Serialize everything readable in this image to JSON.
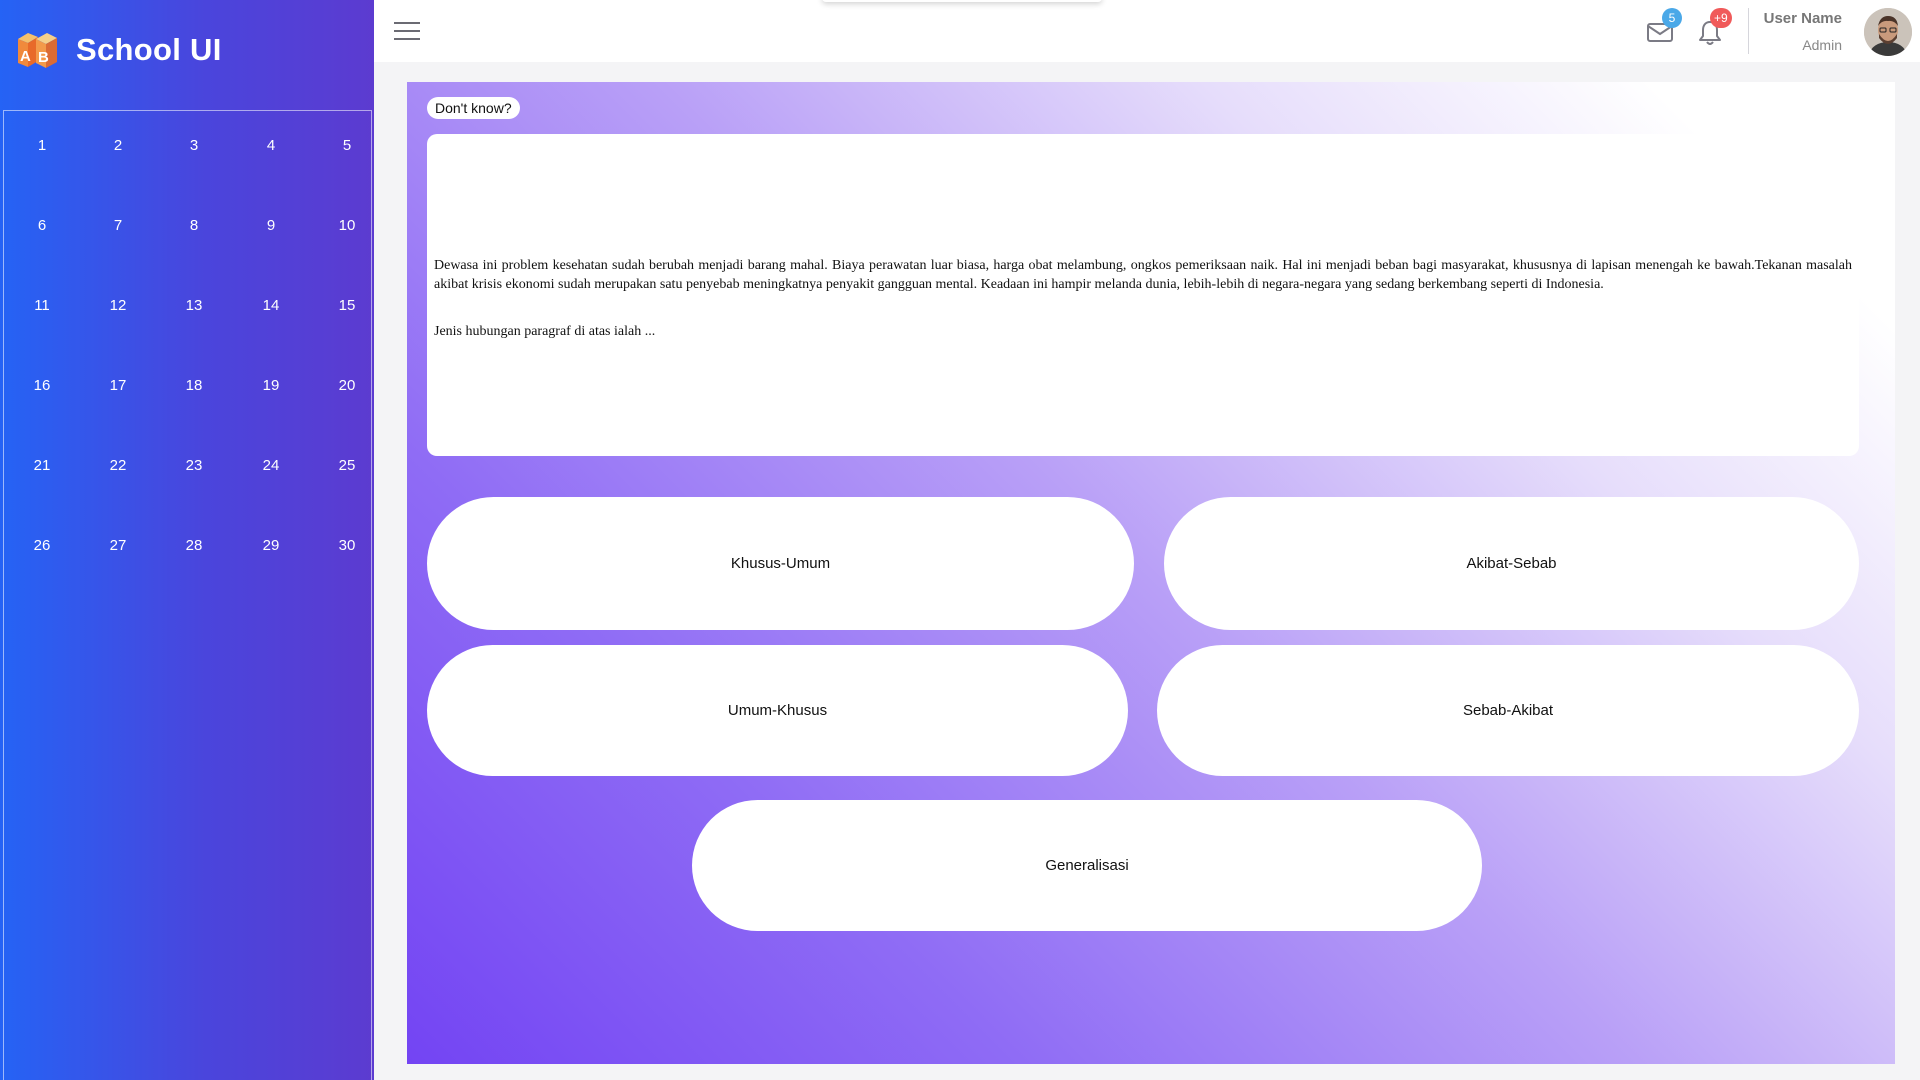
{
  "sidebar": {
    "brand_title": "School UI",
    "logo_letters": {
      "a": "A",
      "b": "B"
    },
    "question_numbers": [
      "1",
      "2",
      "3",
      "4",
      "5",
      "6",
      "7",
      "8",
      "9",
      "10",
      "11",
      "12",
      "13",
      "14",
      "15",
      "16",
      "17",
      "18",
      "19",
      "20",
      "21",
      "22",
      "23",
      "24",
      "25",
      "26",
      "27",
      "28",
      "29",
      "30"
    ]
  },
  "topbar": {
    "mail_badge": "5",
    "notification_badge": "+9",
    "user_name": "User Name",
    "user_role": "Admin"
  },
  "main": {
    "dont_know_label": "Don't know?",
    "question_text": "Dewasa ini problem kesehatan sudah berubah menjadi barang mahal. Biaya perawatan luar biasa, harga obat melambung, ongkos pemeriksaan naik. Hal ini menjadi beban bagi masyarakat, khususnya di lapisan menengah ke bawah.Tekanan masalah akibat krisis ekonomi sudah merupakan satu penyebab meningkatnya penyakit gangguan mental. Keadaan ini hampir melanda dunia, lebih-lebih di negara-negara yang sedang berkembang seperti di Indonesia.",
    "question_prompt": "Jenis hubungan paragraf di atas ialah ...",
    "answers": [
      "Khusus-Umum",
      "Akibat-Sebab",
      "Umum-Khusus",
      "Sebab-Akibat",
      "Generalisasi"
    ]
  },
  "colors": {
    "sidebar_start": "#2563f5",
    "sidebar_end": "#5c3bd0",
    "main_gradient_start": "#7344f3",
    "mail_badge": "#4aa8e8",
    "notification_badge": "#f05a5a"
  },
  "icons": {
    "menu": "hamburger-icon",
    "mail": "envelope-icon",
    "notifications": "bell-icon"
  }
}
